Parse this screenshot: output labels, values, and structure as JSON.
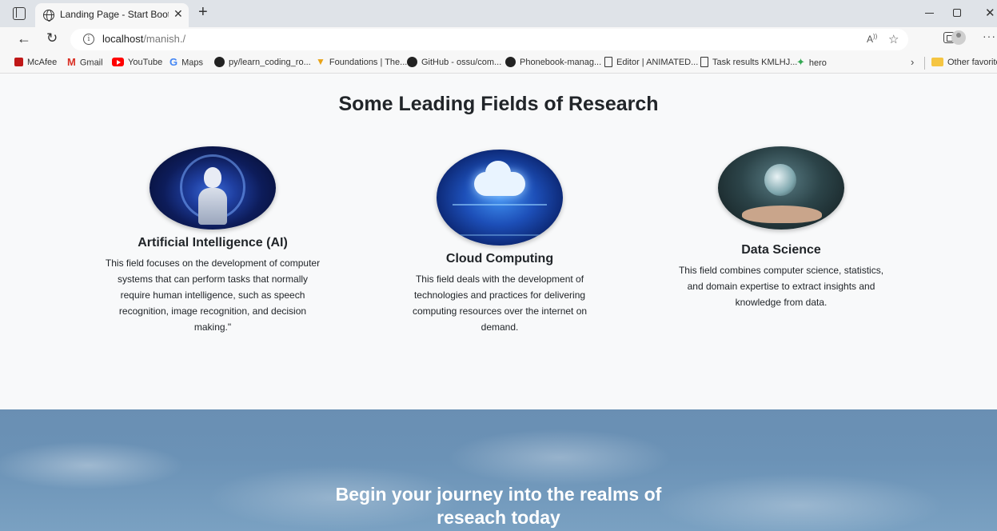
{
  "browser": {
    "tab_title": "Landing Page - Start Bootstrap Th",
    "url_host": "localhost",
    "url_path": "/manish./",
    "bookmarks": [
      {
        "label": "McAfee",
        "icon": "mcafee-icon"
      },
      {
        "label": "Gmail",
        "icon": "gmail-icon"
      },
      {
        "label": "YouTube",
        "icon": "youtube-icon"
      },
      {
        "label": "Maps",
        "icon": "google-maps-icon"
      },
      {
        "label": "py/learn_coding_ro...",
        "icon": "github-icon"
      },
      {
        "label": "Foundations | The...",
        "icon": "foundations-icon"
      },
      {
        "label": "GitHub - ossu/com...",
        "icon": "github-icon"
      },
      {
        "label": "Phonebook-manag...",
        "icon": "github-icon"
      },
      {
        "label": "Editor | ANIMATED...",
        "icon": "page-icon"
      },
      {
        "label": "Task results KMLHJ...",
        "icon": "page-icon"
      },
      {
        "label": "hero",
        "icon": "hero-icon"
      }
    ],
    "other_favorites": "Other favorite"
  },
  "page": {
    "section_title": "Some Leading Fields of Research",
    "features": [
      {
        "title": "Artificial Intelligence (AI)",
        "text": "This field focuses on the development of computer systems that can perform tasks that normally require human intelligence, such as speech recognition, image recognition, and decision making.\""
      },
      {
        "title": "Cloud Computing",
        "text": "This field deals with the development of technologies and practices for delivering computing resources over the internet on demand."
      },
      {
        "title": "Data Science",
        "text": "This field combines computer science, statistics, and domain expertise to extract insights and knowledge from data."
      }
    ],
    "cta": {
      "line1": "Begin your journey into the realms of",
      "line2": "reseach today"
    }
  }
}
